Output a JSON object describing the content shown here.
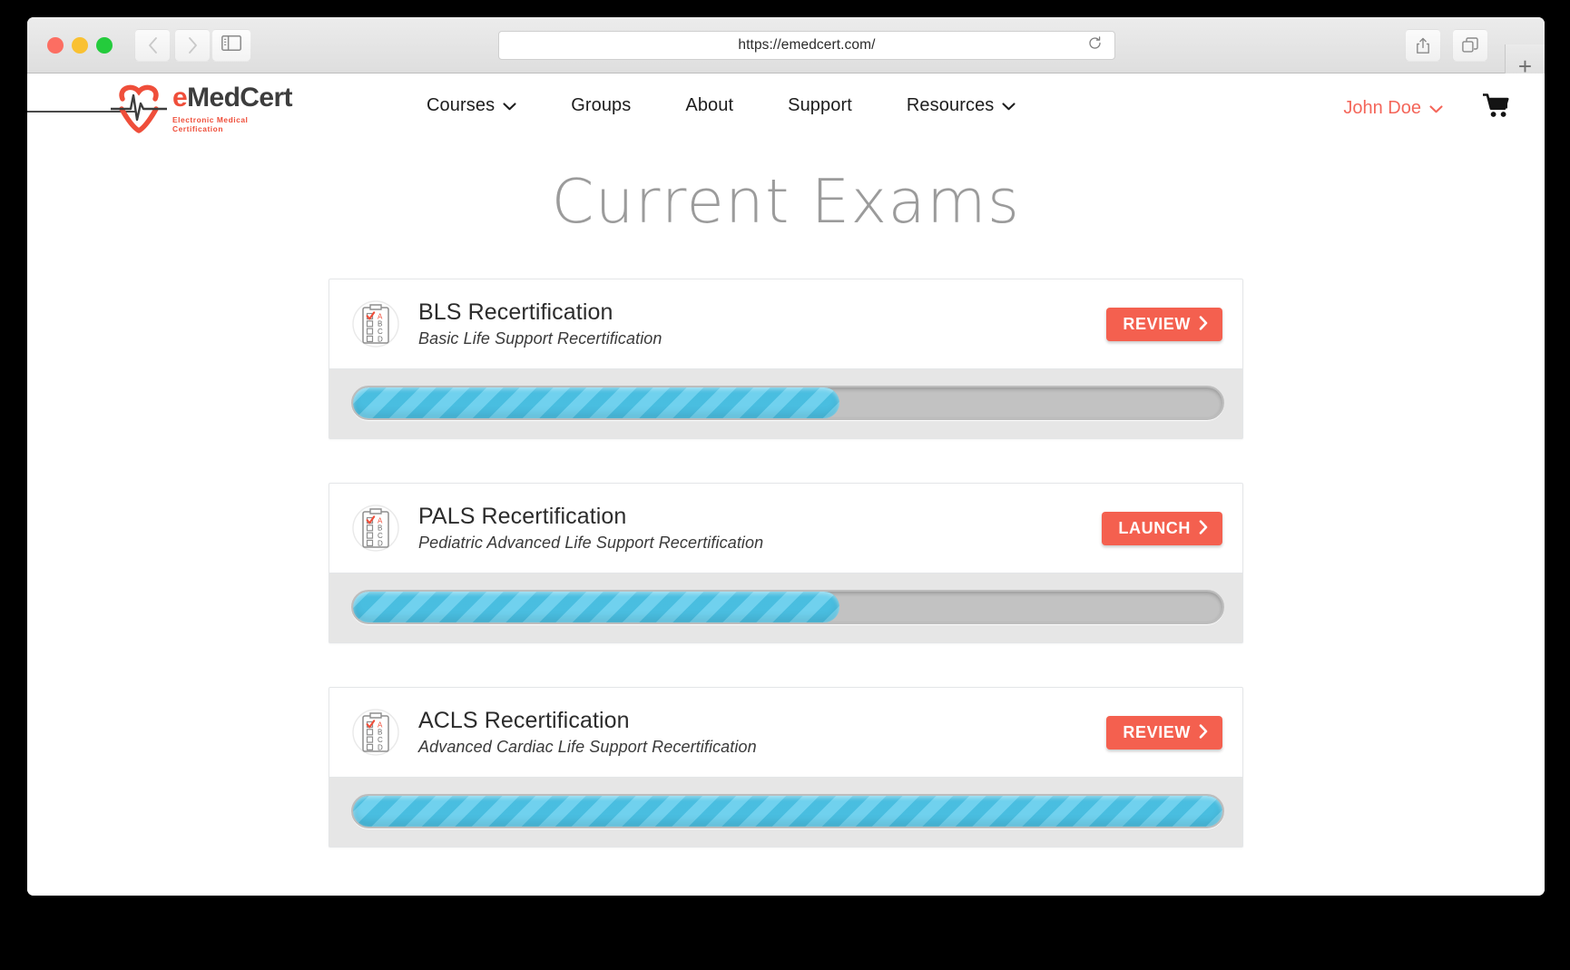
{
  "browser": {
    "url": "https://emedcert.com/",
    "back_label": "Back",
    "forward_label": "Forward",
    "sidebar_label": "Show Sidebar",
    "reload_label": "Reload",
    "share_label": "Share",
    "tabs_label": "Show Tab Overview",
    "new_tab_label": "+"
  },
  "site": {
    "logo": {
      "name_parts": {
        "e": "e",
        "med": "Med",
        "cert": "Cert"
      },
      "name": "eMedCert",
      "tagline": "Electronic Medical Certification"
    },
    "nav": [
      {
        "label": "Courses",
        "has_caret": true
      },
      {
        "label": "Groups",
        "has_caret": false
      },
      {
        "label": "About",
        "has_caret": false
      },
      {
        "label": "Support",
        "has_caret": false
      },
      {
        "label": "Resources",
        "has_caret": true
      }
    ],
    "account": {
      "name": "John Doe",
      "has_caret": true,
      "cart_icon": "shopping-cart-icon"
    }
  },
  "main": {
    "title": "Current Exams",
    "exams": [
      {
        "title": "BLS Recertification",
        "subtitle": "Basic Life Support Recertification",
        "action_label": "REVIEW",
        "progress_percent": 56,
        "icon": "exam-sheet-icon"
      },
      {
        "title": "PALS Recertification",
        "subtitle": "Pediatric Advanced Life Support Recertification",
        "action_label": "LAUNCH",
        "progress_percent": 56,
        "icon": "exam-sheet-icon"
      },
      {
        "title": "ACLS Recertification",
        "subtitle": "Advanced Cardiac Life Support Recertification",
        "action_label": "REVIEW",
        "progress_percent": 100,
        "icon": "exam-sheet-icon"
      }
    ]
  },
  "colors": {
    "brand_red": "#ef4e3a",
    "button_red": "#f4604f",
    "progress_blue": "#4cc6ea",
    "progress_track": "#c2c2c2",
    "title_gray": "#9b9b9b"
  }
}
